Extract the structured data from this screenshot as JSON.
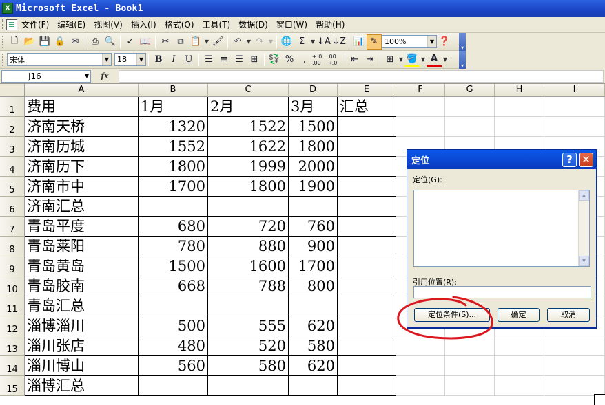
{
  "window": {
    "title": "Microsoft Excel - Book1",
    "app_icon_letter": "X"
  },
  "menu": [
    "文件(F)",
    "编辑(E)",
    "视图(V)",
    "插入(I)",
    "格式(O)",
    "工具(T)",
    "数据(D)",
    "窗口(W)",
    "帮助(H)"
  ],
  "standard_toolbar": {
    "zoom": "100%"
  },
  "formatting_toolbar": {
    "font": "宋体",
    "size": "18",
    "bold": "B",
    "italic": "I",
    "underline": "U",
    "percent": "%",
    "comma": ",",
    "inc_decimal": "+.0 .00",
    "dec_decimal": ".00 →.0",
    "font_color_letter": "A"
  },
  "formula_bar": {
    "name_box": "J16",
    "fx_label": "fx"
  },
  "columns": [
    "A",
    "B",
    "C",
    "D",
    "E",
    "F",
    "G",
    "H",
    "I"
  ],
  "rows": [
    "1",
    "2",
    "3",
    "4",
    "5",
    "6",
    "7",
    "8",
    "9",
    "10",
    "11",
    "12",
    "13",
    "14",
    "15"
  ],
  "cells": [
    [
      "费用",
      "1月",
      "2月",
      "3月",
      "汇总"
    ],
    [
      "济南天桥",
      "1320",
      "1522",
      "1500",
      ""
    ],
    [
      "济南历城",
      "1552",
      "1622",
      "1800",
      ""
    ],
    [
      "济南历下",
      "1800",
      "1999",
      "2000",
      ""
    ],
    [
      "济南市中",
      "1700",
      "1800",
      "1900",
      ""
    ],
    [
      "济南汇总",
      "",
      "",
      "",
      ""
    ],
    [
      "青岛平度",
      "680",
      "720",
      "760",
      ""
    ],
    [
      "青岛莱阳",
      "780",
      "880",
      "900",
      ""
    ],
    [
      "青岛黄岛",
      "1500",
      "1600",
      "1700",
      ""
    ],
    [
      "青岛胶南",
      "668",
      "788",
      "800",
      ""
    ],
    [
      "青岛汇总",
      "",
      "",
      "",
      ""
    ],
    [
      "淄博淄川",
      "500",
      "555",
      "620",
      ""
    ],
    [
      "淄川张店",
      "480",
      "520",
      "580",
      ""
    ],
    [
      "淄川博山",
      "560",
      "580",
      "620",
      ""
    ],
    [
      "淄博汇总",
      "",
      "",
      "",
      ""
    ]
  ],
  "dialog": {
    "title": "定位",
    "help": "?",
    "close": "✕",
    "goto_label": "定位(G):",
    "reference_label": "引用位置(R):",
    "special_button": "定位条件(S)...",
    "ok_button": "确定",
    "cancel_button": "取消"
  },
  "annotation_color": "#d9191f"
}
